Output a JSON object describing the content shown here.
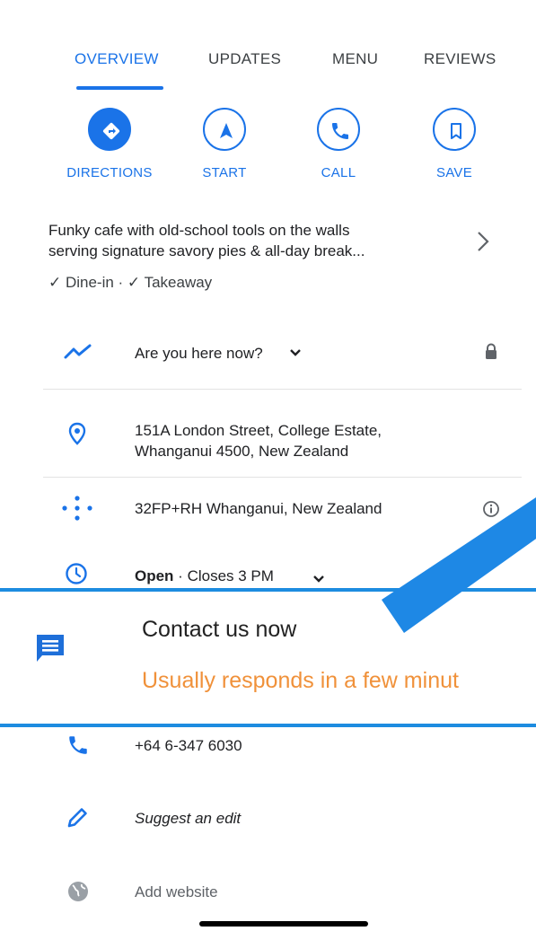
{
  "tabs": [
    {
      "label": "OVERVIEW",
      "active": true
    },
    {
      "label": "UPDATES",
      "active": false
    },
    {
      "label": "MENU",
      "active": false
    },
    {
      "label": "REVIEWS",
      "active": false
    }
  ],
  "actions": [
    {
      "label": "DIRECTIONS",
      "icon": "directions-icon"
    },
    {
      "label": "START",
      "icon": "navigation-arrow-icon"
    },
    {
      "label": "CALL",
      "icon": "phone-icon"
    },
    {
      "label": "SAVE",
      "icon": "bookmark-icon"
    }
  ],
  "description": {
    "line1": "Funky cafe with old-school tools on the walls",
    "line2": "serving signature savory pies & all-day break...",
    "amenities": "✓ Dine-in · ✓ Takeaway"
  },
  "here_now": {
    "text": "Are you here now?"
  },
  "address": {
    "line1": "151A London Street, College Estate,",
    "line2": "Whanganui 4500, New Zealand"
  },
  "plus_code": {
    "text": "32FP+RH Whanganui, New Zealand"
  },
  "hours": {
    "status": "Open",
    "separator": " · ",
    "closes": "Closes 3 PM"
  },
  "contact": {
    "title": "Contact us now",
    "subtitle": "Usually responds in a few minut"
  },
  "phone": {
    "number": "+64 6-347 6030"
  },
  "suggest_edit": {
    "label": "Suggest an edit"
  },
  "website": {
    "label": "Add website"
  },
  "colors": {
    "accent": "#1a73e8",
    "contact_border": "#1d8ce0",
    "contact_subtitle": "#f0913a",
    "overlay_arrow": "#1e88e5"
  }
}
